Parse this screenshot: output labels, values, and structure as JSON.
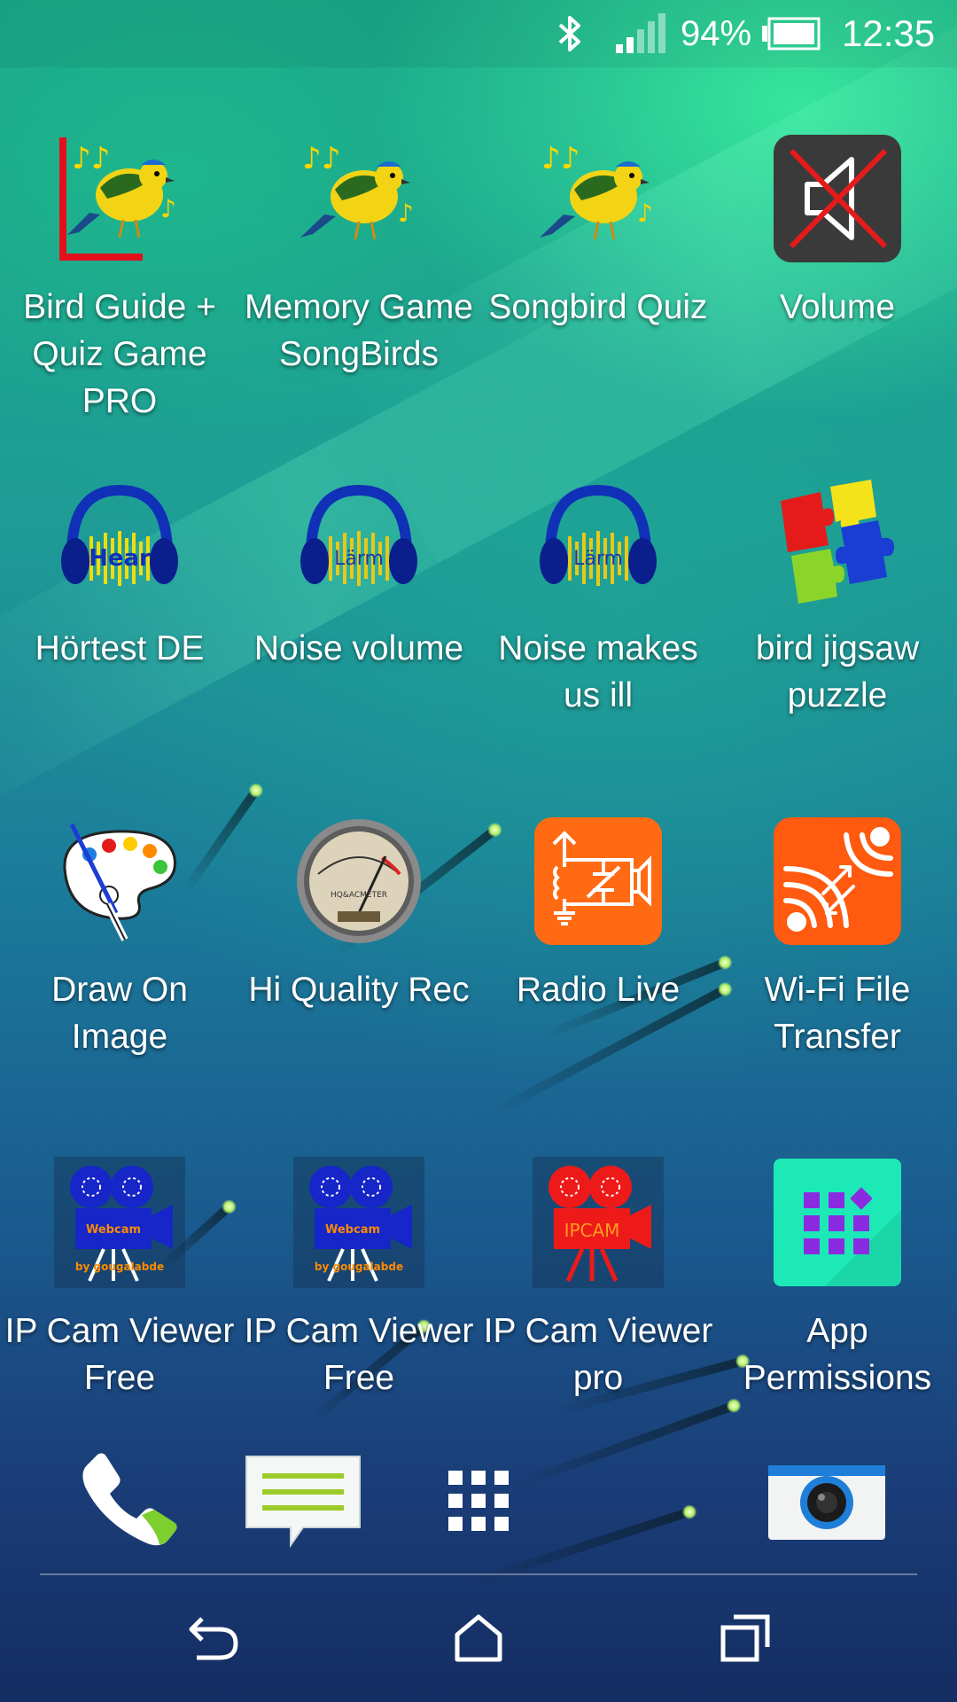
{
  "status_bar": {
    "battery_percent": "94%",
    "battery_level": 0.94,
    "time": "12:35",
    "icons": [
      "bluetooth-icon",
      "signal-icon",
      "battery-icon"
    ]
  },
  "home_screen": {
    "apps": [
      {
        "label": "Bird Guide + Quiz Game PRO",
        "icon": "bird-guide-icon"
      },
      {
        "label": "Memory Game SongBirds",
        "icon": "songbird-icon"
      },
      {
        "label": "Songbird Quiz",
        "icon": "songbird-icon"
      },
      {
        "label": "Volume",
        "icon": "volume-muted-icon"
      },
      {
        "label": "Hörtest DE",
        "icon": "headphones-icon",
        "icon_text": "Hear"
      },
      {
        "label": "Noise volume",
        "icon": "headphones-icon",
        "icon_text": "Lärm"
      },
      {
        "label": "Noise makes us ill",
        "icon": "headphones-icon",
        "icon_text": "Lärm"
      },
      {
        "label": "bird jigsaw puzzle",
        "icon": "puzzle-icon"
      },
      {
        "label": "Draw On Image",
        "icon": "palette-icon"
      },
      {
        "label": "Hi Quality Rec",
        "icon": "vu-meter-icon",
        "icon_text": "HQ&ACMETER"
      },
      {
        "label": "Radio Live",
        "icon": "radio-circuit-icon"
      },
      {
        "label": "Wi-Fi File Transfer",
        "icon": "wifi-transfer-icon"
      },
      {
        "label": "IP Cam Viewer Free",
        "icon": "webcam-icon",
        "icon_text": "Webcam",
        "icon_subtext": "by gougalabde"
      },
      {
        "label": "IP Cam Viewer Free",
        "icon": "webcam-icon",
        "icon_text": "Webcam",
        "icon_subtext": "by gougalabde"
      },
      {
        "label": "IP Cam Viewer pro",
        "icon": "ipcam-icon",
        "icon_text": "IPCAM"
      },
      {
        "label": "App Permissions",
        "icon": "app-permissions-icon"
      }
    ]
  },
  "dock": [
    {
      "name": "phone",
      "icon": "phone-icon"
    },
    {
      "name": "messages",
      "icon": "messages-icon"
    },
    {
      "name": "all-apps",
      "icon": "app-drawer-icon"
    },
    {
      "name": "camera",
      "icon": "camera-icon"
    }
  ],
  "nav_bar": [
    {
      "name": "back",
      "icon": "back-icon"
    },
    {
      "name": "home",
      "icon": "home-icon"
    },
    {
      "name": "recents",
      "icon": "recents-icon"
    }
  ],
  "colors": {
    "orange_tile": "#ff6a13",
    "teal_tile": "#1de9b6",
    "dark_tile": "#3a3a3a",
    "headphone_blue": "#1030b8",
    "webcam_blue": "#1626c8",
    "ipcam_red": "#ee1a1a"
  }
}
